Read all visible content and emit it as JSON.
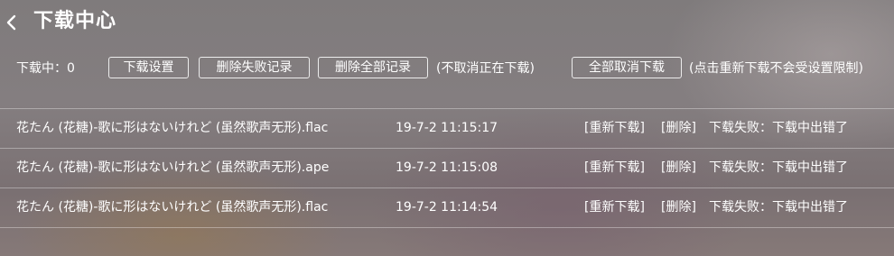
{
  "header": {
    "title": "下载中心"
  },
  "toolbar": {
    "downloading_label": "下载中：0",
    "settings_button": "下载设置",
    "delete_failed_button": "删除失败记录",
    "delete_all_button": "删除全部记录",
    "delete_all_note": "(不取消正在下载)",
    "cancel_all_button": "全部取消下载",
    "cancel_all_note": "(点击重新下载不会受设置限制)"
  },
  "downloads": [
    {
      "name": "花たん (花糖)-歌に形はないけれど (虽然歌声无形).flac",
      "time": "19-7-2 11:15:17",
      "retry_label": "[重新下载]",
      "delete_label": "[删除]",
      "status": "下载失败：下载中出错了"
    },
    {
      "name": "花たん (花糖)-歌に形はないけれど (虽然歌声无形).ape",
      "time": "19-7-2 11:15:08",
      "retry_label": "[重新下载]",
      "delete_label": "[删除]",
      "status": "下载失败：下载中出错了"
    },
    {
      "name": "花たん (花糖)-歌に形はないけれど (虽然歌声无形).flac",
      "time": "19-7-2 11:14:54",
      "retry_label": "[重新下载]",
      "delete_label": "[删除]",
      "status": "下载失败：下载中出错了"
    }
  ]
}
